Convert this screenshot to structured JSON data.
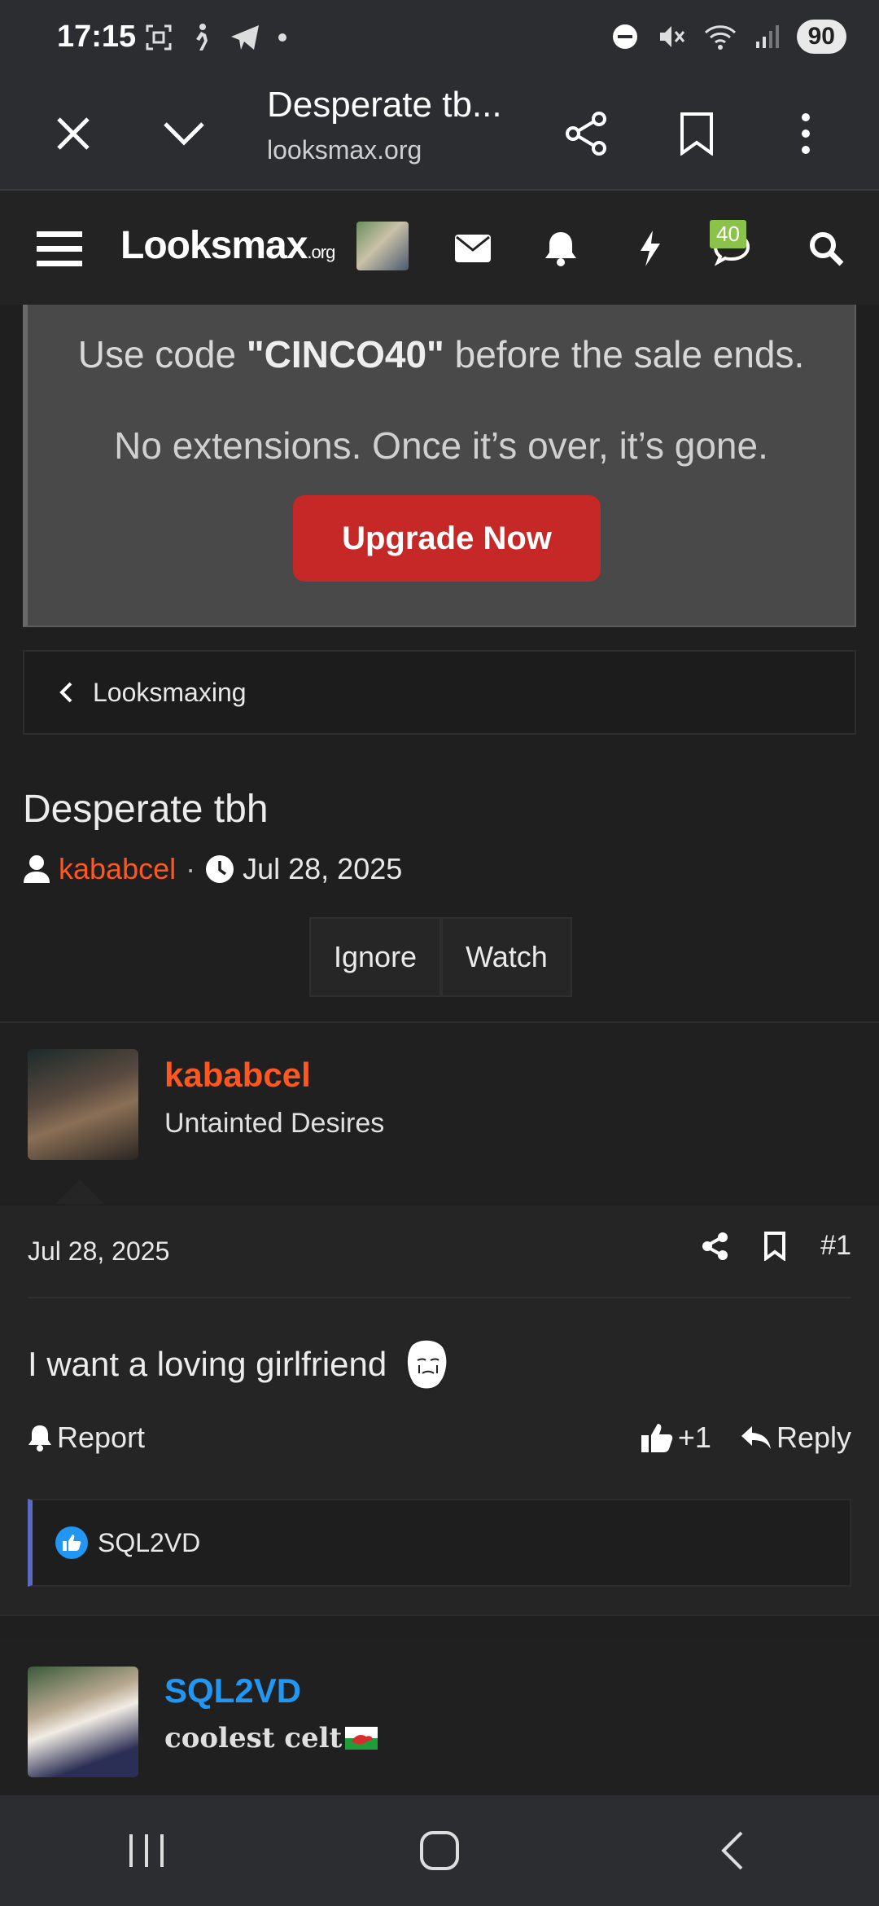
{
  "status_bar": {
    "time": "17:15",
    "battery": "90"
  },
  "browser": {
    "title": "Desperate tb...",
    "url": "looksmax.org"
  },
  "site_nav": {
    "logo_main": "Looksmax",
    "logo_suffix": ".org",
    "notification_badge": "40"
  },
  "promo": {
    "line1_prefix": "Use code ",
    "code": "\"CINCO40\"",
    "line1_suffix": " before the sale ends.",
    "line2": "No extensions. Once it’s over, it’s gone.",
    "button": "Upgrade Now"
  },
  "breadcrumb": {
    "label": "Looksmaxing"
  },
  "thread": {
    "title": "Desperate tbh",
    "author": "kababcel",
    "separator": "·",
    "date": "Jul 28, 2025",
    "actions": [
      "Ignore",
      "Watch"
    ]
  },
  "post1": {
    "username": "kababcel",
    "user_title": "Untainted Desires",
    "date": "Jul 28, 2025",
    "post_number": "#1",
    "text": "I want a loving girlfriend",
    "report": "Report",
    "like_count": "+1",
    "reply": "Reply",
    "reaction_user": "SQL2VD"
  },
  "post2": {
    "username": "SQL2VD",
    "user_title": "coolest celt"
  },
  "colors": {
    "accent_orange": "#ff5722",
    "accent_blue": "#2196f3",
    "button_red": "#c62828"
  }
}
